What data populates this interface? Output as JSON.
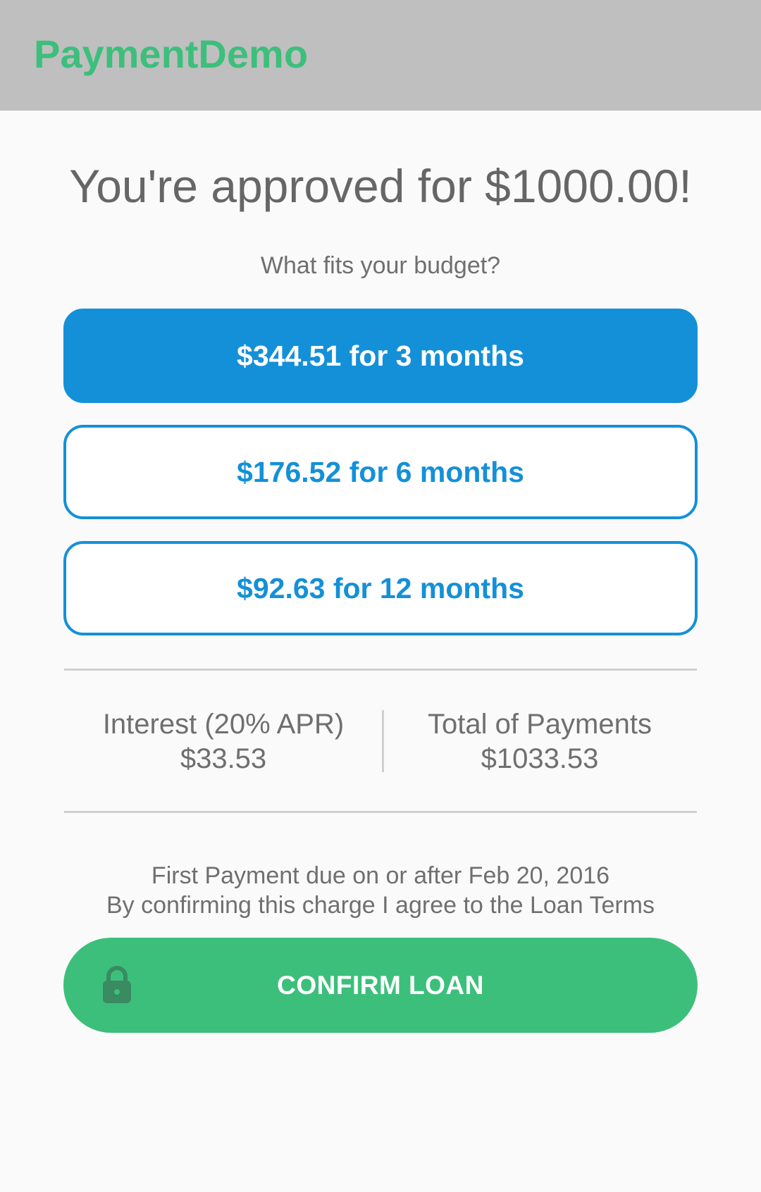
{
  "app_bar": {
    "title": "PaymentDemo"
  },
  "main": {
    "headline": "You're approved for $1000.00!",
    "subhead": "What fits your budget?",
    "plans": [
      {
        "label": "$344.51 for 3 months",
        "selected": true
      },
      {
        "label": "$176.52 for 6 months",
        "selected": false
      },
      {
        "label": "$92.63 for 12 months",
        "selected": false
      }
    ],
    "interest": {
      "label": "Interest (20% APR)",
      "value": "$33.53"
    },
    "total": {
      "label": "Total of Payments",
      "value": "$1033.53"
    },
    "first_payment": "First Payment due on or after Feb 20, 2016",
    "agreement": "By confirming this charge I agree to the Loan Terms",
    "confirm_label": "CONFIRM LOAN",
    "confirm_icon": "lock-icon"
  },
  "colors": {
    "brand_green": "#3dbf7c",
    "accent_blue": "#1490d8",
    "app_bar_gray": "#bfbfbf",
    "text_gray": "#6f6f6f"
  }
}
